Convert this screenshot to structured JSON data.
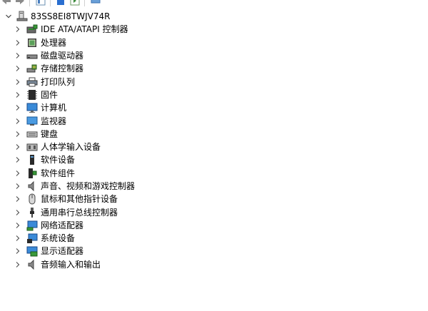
{
  "toolbar": {
    "icons": [
      "back-arrow-icon",
      "forward-arrow-icon",
      "show-hide-tree-icon",
      "properties-icon",
      "help-icon",
      "scan-hardware-icon"
    ]
  },
  "tree": {
    "computer_name": "83SS8EI8TWJV74R",
    "categories": [
      {
        "label": "IDE ATA/ATAPI 控制器",
        "icon": "ide-controller-icon"
      },
      {
        "label": "处理器",
        "icon": "processor-icon"
      },
      {
        "label": "磁盘驱动器",
        "icon": "disk-drive-icon"
      },
      {
        "label": "存储控制器",
        "icon": "storage-controller-icon"
      },
      {
        "label": "打印队列",
        "icon": "printer-icon"
      },
      {
        "label": "固件",
        "icon": "firmware-icon"
      },
      {
        "label": "计算机",
        "icon": "computer-icon"
      },
      {
        "label": "监视器",
        "icon": "monitor-icon"
      },
      {
        "label": "键盘",
        "icon": "keyboard-icon"
      },
      {
        "label": "人体学输入设备",
        "icon": "hid-icon"
      },
      {
        "label": "软件设备",
        "icon": "software-device-icon"
      },
      {
        "label": "软件组件",
        "icon": "software-component-icon"
      },
      {
        "label": "声音、视频和游戏控制器",
        "icon": "sound-icon"
      },
      {
        "label": "鼠标和其他指针设备",
        "icon": "mouse-icon"
      },
      {
        "label": "通用串行总线控制器",
        "icon": "usb-icon"
      },
      {
        "label": "网络适配器",
        "icon": "network-adapter-icon"
      },
      {
        "label": "系统设备",
        "icon": "system-device-icon"
      },
      {
        "label": "显示适配器",
        "icon": "display-adapter-icon"
      },
      {
        "label": "音频输入和输出",
        "icon": "audio-io-icon"
      }
    ]
  }
}
